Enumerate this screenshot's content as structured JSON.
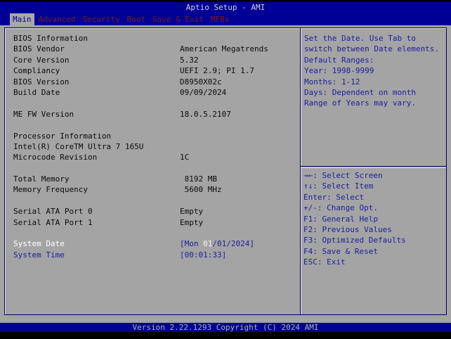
{
  "titlebar": {
    "title": "Aptio Setup - AMI"
  },
  "menu": {
    "selected": "Main",
    "items": [
      {
        "label": "Main"
      },
      {
        "label": "Advanced"
      },
      {
        "label": "Security"
      },
      {
        "label": "Boot"
      },
      {
        "label": "Save & Exit"
      },
      {
        "label": "MEBx"
      }
    ]
  },
  "main_panel": {
    "rows": [
      {
        "label": "BIOS Information",
        "value": ""
      },
      {
        "label": "BIOS Vendor",
        "value": "American Megatrends"
      },
      {
        "label": "Core Version",
        "value": "5.32"
      },
      {
        "label": "Compliancy",
        "value": "UEFI 2.9; PI 1.7"
      },
      {
        "label": "BIOS Version",
        "value": "D8950X02c"
      },
      {
        "label": "Build Date",
        "value": "09/09/2024"
      },
      {
        "label": "",
        "value": ""
      },
      {
        "label": "ME FW Version",
        "value": "18.0.5.2107"
      },
      {
        "label": "",
        "value": ""
      },
      {
        "label": "Processor Information",
        "value": ""
      },
      {
        "label": "Intel(R) CoreTM Ultra 7 165U",
        "value": ""
      },
      {
        "label": "Microcode Revision",
        "value": "1C"
      },
      {
        "label": "",
        "value": ""
      },
      {
        "label": "Total Memory",
        "value": " 8192 MB"
      },
      {
        "label": "Memory Frequency",
        "value": " 5600 MHz"
      },
      {
        "label": "",
        "value": ""
      },
      {
        "label": "Serial ATA Port 0",
        "value": "Empty"
      },
      {
        "label": "Serial ATA Port 1",
        "value": "Empty"
      },
      {
        "label": "",
        "value": ""
      }
    ],
    "system_date": {
      "label": "System Date",
      "value_prefix": "[Mon ",
      "value_selected": "01",
      "value_suffix": "/01/2024]"
    },
    "system_time": {
      "label": "System Time",
      "value": "[00:01:33]"
    }
  },
  "help_panel": {
    "lines": [
      "Set the Date. Use Tab to",
      "switch between Date elements.",
      "Default Ranges:",
      "Year: 1998-9999",
      "Months: 1-12",
      "Days: Dependent on month",
      "Range of Years may vary."
    ]
  },
  "keys_panel": {
    "lines": [
      "→←: Select Screen",
      "↑↓: Select Item",
      "Enter: Select",
      "+/-: Change Opt.",
      "F1: General Help",
      "F2: Previous Values",
      "F3: Optimized Defaults",
      "F4: Save & Reset",
      "ESC: Exit"
    ]
  },
  "footer": {
    "text": "Version 2.22.1293 Copyright (C) 2024 AMI"
  },
  "colors": {
    "band_blue": "#000096",
    "content_gray": "#a4a4a4",
    "menu_maroon": "#7c1d1d",
    "text_blue": "#1c1c9c",
    "selected_tab_text": "#00008b",
    "border_blue": "#00005f",
    "selected_item_text": "#ffffff"
  }
}
